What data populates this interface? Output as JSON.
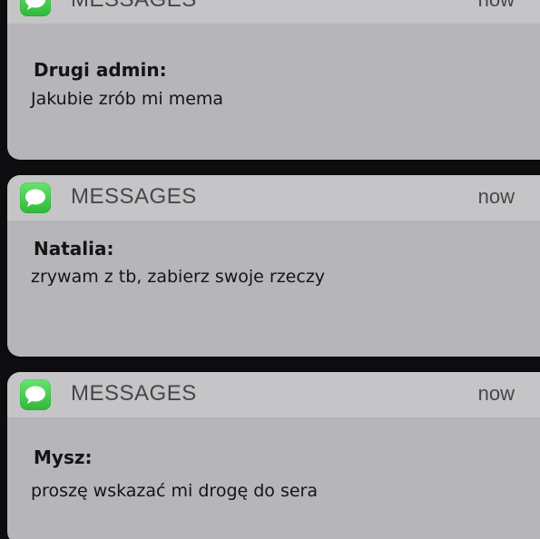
{
  "notifications": [
    {
      "app_name": "MESSAGES",
      "time": "now",
      "icon": "messages-app-icon",
      "sender": "Drugi admin:",
      "message": "Jakubie zrób mi mema"
    },
    {
      "app_name": "MESSAGES",
      "time": "now",
      "icon": "messages-app-icon",
      "sender": "Natalia:",
      "message": "zrywam z tb, zabierz swoje rzeczy"
    },
    {
      "app_name": "MESSAGES",
      "time": "now",
      "icon": "messages-app-icon",
      "sender": "Mysz:",
      "message": "proszę wskazać mi drogę do sera"
    }
  ],
  "colors": {
    "background": "#0d0d0f",
    "header": "#c5c5c8",
    "body": "#b6b6ba",
    "icon_green": "#3cc447"
  }
}
